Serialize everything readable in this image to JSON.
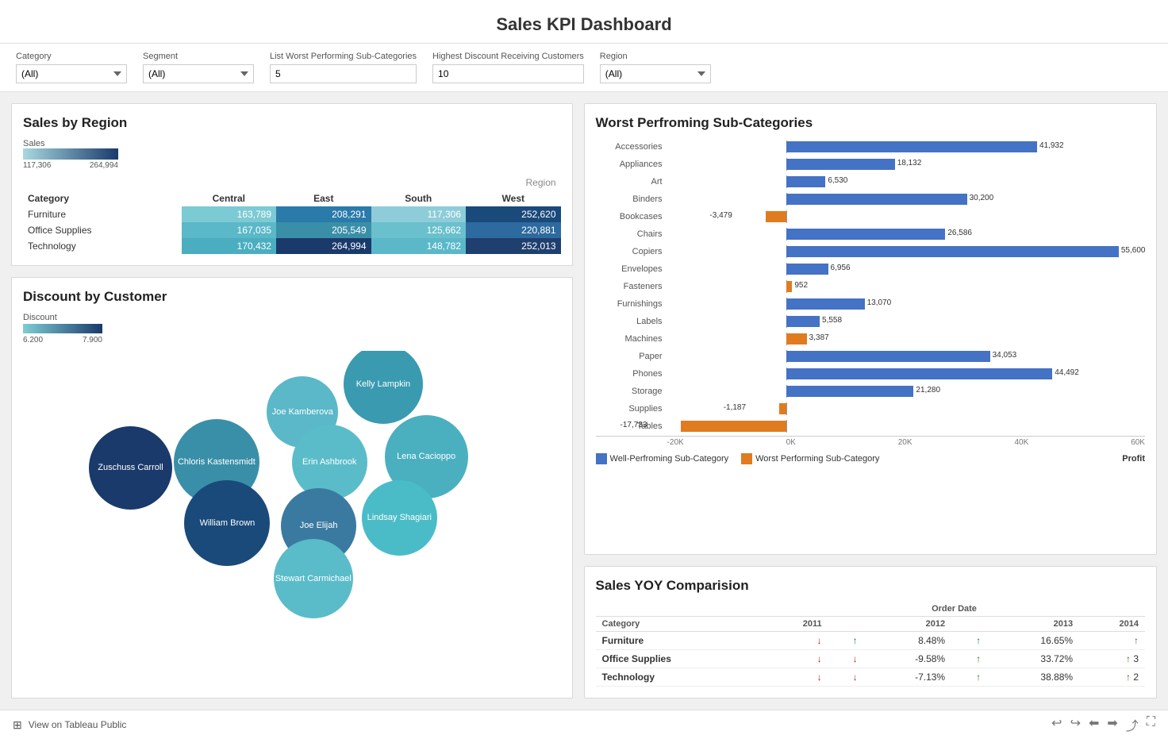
{
  "title": "Sales KPI Dashboard",
  "filters": {
    "category_label": "Category",
    "category_value": "(All)",
    "segment_label": "Segment",
    "segment_value": "(All)",
    "worst_label": "List Worst Performing Sub-Categories",
    "worst_value": "5",
    "highest_label": "Highest Discount Receiving Customers",
    "highest_value": "10",
    "region_label": "Region",
    "region_value": "(All)"
  },
  "sales_by_region": {
    "title": "Sales by Region",
    "legend_title": "Sales",
    "legend_min": "117,306",
    "legend_max": "264,994",
    "region_label": "Region",
    "columns": [
      "Category",
      "Central",
      "East",
      "South",
      "West"
    ],
    "rows": [
      {
        "category": "Furniture",
        "central": "163,789",
        "east": "208,291",
        "south": "117,306",
        "west": "252,620"
      },
      {
        "category": "Office Supplies",
        "central": "167,035",
        "east": "205,549",
        "south": "125,662",
        "west": "220,881"
      },
      {
        "category": "Technology",
        "central": "170,432",
        "east": "264,994",
        "south": "148,782",
        "west": "252,013"
      }
    ]
  },
  "discount_by_customer": {
    "title": "Discount by Customer",
    "legend_title": "Discount",
    "legend_min": "6.200",
    "legend_max": "7.900",
    "bubbles": [
      {
        "name": "Joe Kamberova",
        "x": 52,
        "y": 22,
        "size": 90,
        "color": "#5ab8c8"
      },
      {
        "name": "Kelly Lampkin",
        "x": 67,
        "y": 12,
        "size": 100,
        "color": "#3a9ab0"
      },
      {
        "name": "Lena Cacioppo",
        "x": 75,
        "y": 38,
        "size": 105,
        "color": "#4ab0c0"
      },
      {
        "name": "Erin Ashbrook",
        "x": 57,
        "y": 40,
        "size": 95,
        "color": "#5abcc8"
      },
      {
        "name": "Chloris Kastensmidt",
        "x": 36,
        "y": 40,
        "size": 108,
        "color": "#3a8fa8"
      },
      {
        "name": "Zuschuss Carroll",
        "x": 20,
        "y": 42,
        "size": 105,
        "color": "#1a3a6b"
      },
      {
        "name": "Lindsay Shagiari",
        "x": 70,
        "y": 60,
        "size": 95,
        "color": "#4abcc8"
      },
      {
        "name": "William Brown",
        "x": 38,
        "y": 62,
        "size": 108,
        "color": "#1a4a7a"
      },
      {
        "name": "Joe Elijah",
        "x": 55,
        "y": 63,
        "size": 95,
        "color": "#3a7aa0"
      },
      {
        "name": "Stewart Carmichael",
        "x": 54,
        "y": 82,
        "size": 100,
        "color": "#5abcc8"
      }
    ]
  },
  "worst_sub_categories": {
    "title": "Worst Perfroming Sub-Categories",
    "legend_well": "Well-Perfroming Sub-Category",
    "legend_worst": "Worst Performing Sub-Category",
    "axis_label": "Profit",
    "categories": [
      {
        "name": "Accessories",
        "value": 41932,
        "type": "well"
      },
      {
        "name": "Appliances",
        "value": 18132,
        "type": "well"
      },
      {
        "name": "Art",
        "value": 6530,
        "type": "well"
      },
      {
        "name": "Binders",
        "value": 30200,
        "type": "well"
      },
      {
        "name": "Bookcases",
        "value": -3479,
        "type": "worst"
      },
      {
        "name": "Chairs",
        "value": 26586,
        "type": "well"
      },
      {
        "name": "Copiers",
        "value": 55600,
        "type": "well"
      },
      {
        "name": "Envelopes",
        "value": 6956,
        "type": "well"
      },
      {
        "name": "Fasteners",
        "value": 952,
        "type": "worst"
      },
      {
        "name": "Furnishings",
        "value": 13070,
        "type": "well"
      },
      {
        "name": "Labels",
        "value": 5558,
        "type": "well"
      },
      {
        "name": "Machines",
        "value": 3387,
        "type": "worst"
      },
      {
        "name": "Paper",
        "value": 34053,
        "type": "well"
      },
      {
        "name": "Phones",
        "value": 44492,
        "type": "well"
      },
      {
        "name": "Storage",
        "value": 21280,
        "type": "well"
      },
      {
        "name": "Supplies",
        "value": -1187,
        "type": "worst"
      },
      {
        "name": "Tables",
        "value": -17733,
        "type": "worst"
      }
    ]
  },
  "yoy": {
    "title": "Sales YOY Comparision",
    "order_date_label": "Order Date",
    "columns": [
      "Category",
      "2011",
      "2012",
      "",
      "2013",
      "",
      "2014"
    ],
    "rows": [
      {
        "category": "Furniture",
        "y2011": "down",
        "y2012_arrow": "up",
        "y2012": "8.48%",
        "y2013_arrow": "up",
        "y2013": "16.65%",
        "y2014_arrow": "up"
      },
      {
        "category": "Office Supplies",
        "y2011": "down",
        "y2012_arrow": "down",
        "y2012": "-9.58%",
        "y2013_arrow": "up",
        "y2013": "33.72%",
        "y2014_arrow": "up",
        "y2014": "3"
      },
      {
        "category": "Technology",
        "y2011": "down",
        "y2012_arrow": "down",
        "y2012": "-7.13%",
        "y2013_arrow": "up",
        "y2013": "38.88%",
        "y2014_arrow": "up",
        "y2014": "2"
      }
    ]
  },
  "bottom_bar": {
    "link_text": "View on Tableau Public",
    "nav_icons": [
      "undo",
      "redo",
      "back",
      "forward",
      "share",
      "fullscreen"
    ]
  }
}
